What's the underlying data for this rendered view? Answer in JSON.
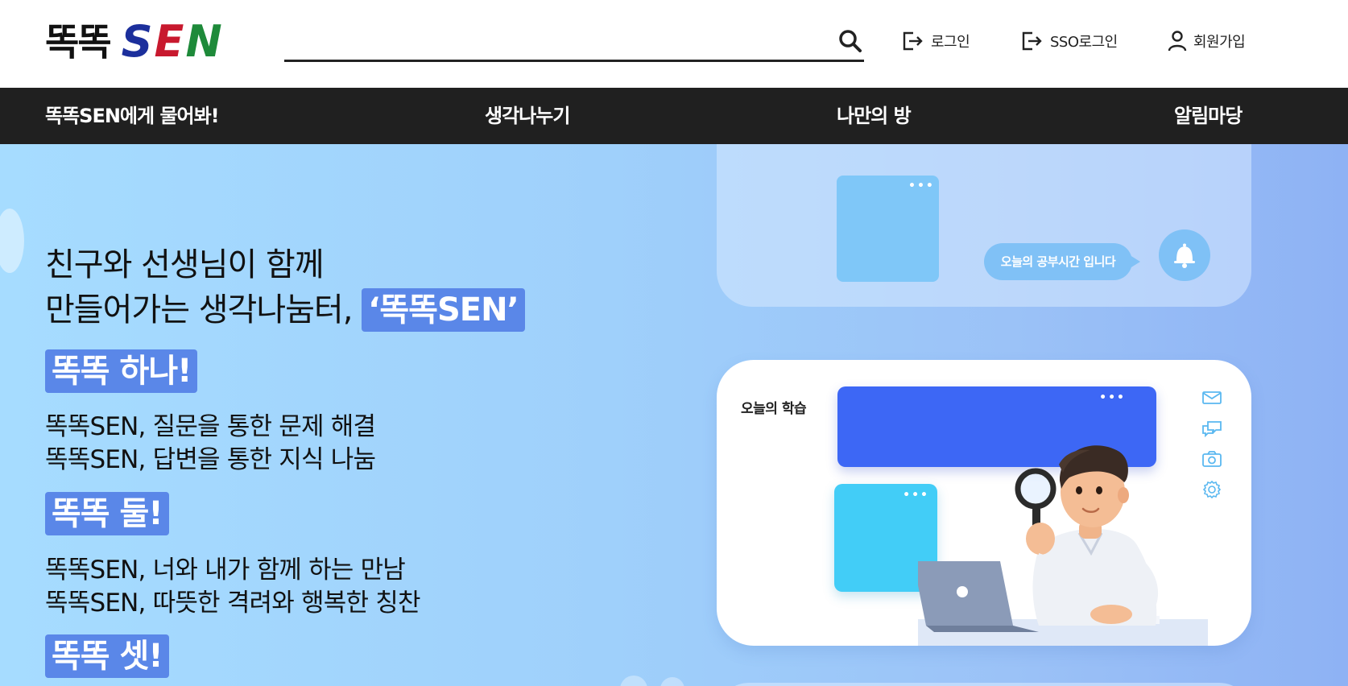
{
  "header": {
    "logo_text_ko": "똑똑",
    "logo_sen": {
      "s": "S",
      "e": "E",
      "n": "N"
    },
    "search": {
      "value": "",
      "placeholder": ""
    },
    "login_label": "로그인",
    "sso_login_label": "SSO로그인",
    "signup_label": "회원가입"
  },
  "nav": {
    "items": [
      {
        "label": "똑똑SEN에게 물어봐!"
      },
      {
        "label": "생각나누기"
      },
      {
        "label": "나만의 방"
      },
      {
        "label": "알림마당"
      }
    ]
  },
  "hero": {
    "headline_line1": "친구와 선생님이 함께",
    "headline_line2_prefix": "만들어가는 생각나눔터,",
    "headline_highlight": "‘똑똑SEN’",
    "sections": [
      {
        "title": "똑똑 하나!",
        "lines": [
          "똑똑SEN, 질문을 통한 문제 해결",
          "똑똑SEN, 답변을 통한 지식 나눔"
        ]
      },
      {
        "title": "똑똑 둘!",
        "lines": [
          "똑똑SEN, 너와 내가 함께 하는 만남",
          "똑똑SEN, 따뜻한 격려와 행복한 칭찬"
        ]
      },
      {
        "title": "똑똑 셋!",
        "lines": []
      }
    ],
    "illustration": {
      "bubble_text": "오늘의 공부시간 입니다",
      "card_label": "오늘의 학습",
      "dots": "•••"
    }
  },
  "colors": {
    "nav_bg": "#202020",
    "highlight_chip": "#5a87e8",
    "hero_bg_start": "#a6dcff",
    "hero_bg_end": "#8eb2f4",
    "blue_card": "#3d67f5",
    "cyan_card": "#42cdf7"
  },
  "icons": {
    "search": "search-icon",
    "login": "login-icon",
    "sso_login": "login-icon",
    "signup": "user-icon"
  }
}
